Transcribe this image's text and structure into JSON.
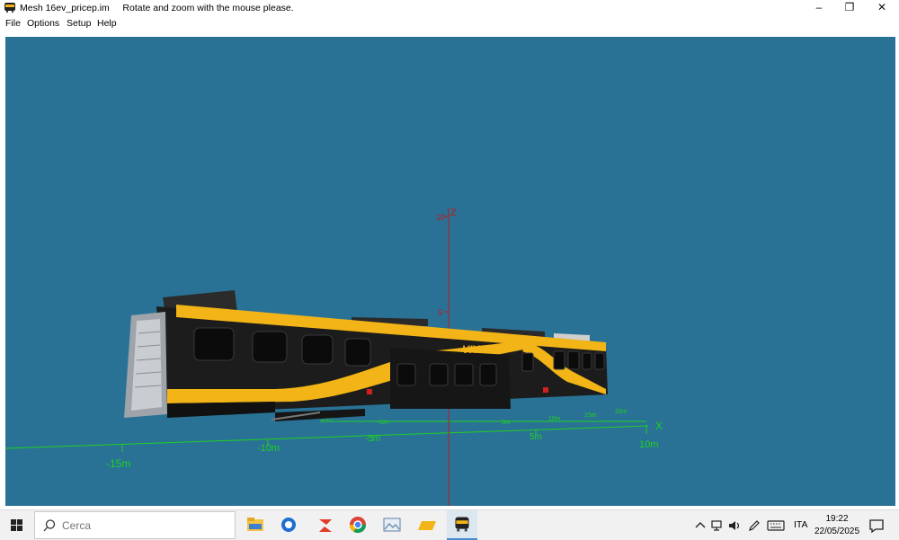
{
  "window": {
    "file_name": "Mesh 16ev_pricep.im",
    "instruction": "Rotate and zoom with the mouse please.",
    "minimize_label": "–",
    "restore_label": "❐",
    "close_label": "✕"
  },
  "menu": {
    "items": [
      {
        "label": "File"
      },
      {
        "label": "Options"
      },
      {
        "label": "Setup"
      },
      {
        "label": "Help"
      }
    ]
  },
  "viewport": {
    "background_color": "#297296",
    "axis_color": "#20d020",
    "z_axis_color": "#c21818",
    "z_label": "Z",
    "x_label": "X",
    "z_ticks": [
      {
        "value": 10,
        "label": "10"
      },
      {
        "value": 5,
        "label": "5"
      }
    ],
    "near_axis_ticks": [
      {
        "label": "-15m"
      },
      {
        "label": "-10m"
      },
      {
        "label": "-5m"
      },
      {
        "label": "5m"
      },
      {
        "label": "10m"
      }
    ],
    "far_axis_ticks": [
      {
        "label": "-10m"
      },
      {
        "label": "-5m"
      },
      {
        "label": "5m"
      },
      {
        "label": "10m"
      },
      {
        "label": "15m"
      },
      {
        "label": "20m"
      }
    ],
    "train": {
      "body_color": "#1c1c1c",
      "stripe_color": "#f2b417",
      "logo_text": "VIVI"
    }
  },
  "taskbar": {
    "search_placeholder": "Cerca",
    "apps": [
      {
        "name": "file-explorer-icon"
      },
      {
        "name": "app-blue-icon"
      },
      {
        "name": "app-red-icon"
      },
      {
        "name": "chrome-icon"
      },
      {
        "name": "photos-icon"
      },
      {
        "name": "folder-yellow-icon"
      },
      {
        "name": "train-viewer-icon"
      }
    ],
    "language": "ITA",
    "time": "19:22",
    "date": "22/05/2025"
  }
}
